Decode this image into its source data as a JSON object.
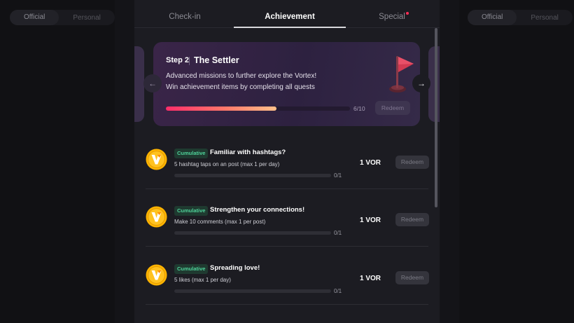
{
  "background": {
    "left_segment": [
      "Official",
      "Personal"
    ],
    "right_segment": [
      "Official",
      "Personal"
    ]
  },
  "tabs": [
    {
      "label": "Check-in",
      "active": false
    },
    {
      "label": "Achievement",
      "active": true
    },
    {
      "label": "Special",
      "active": false,
      "has_notification_dot": true
    }
  ],
  "step_card": {
    "step": "Step 2",
    "title": "The Settler",
    "desc_line1": "Advanced missions to further explore the Vortex!",
    "desc_line2": "Win achievement items by completing all quests",
    "progress": 0.6,
    "progress_text": "6/10",
    "redeem_label": "Redeem",
    "icon": "flag-icon"
  },
  "missions": [
    {
      "badge": "Cumulative",
      "title": "Familiar with hashtags?",
      "desc": "5 hashtag taps on an post (max 1 per day)",
      "progress": 0,
      "progress_text": "0/1",
      "reward": "1 VOR",
      "redeem_label": "Redeem",
      "icon": "vortex-coin-icon"
    },
    {
      "badge": "Cumulative",
      "title": "Strengthen your connections!",
      "desc": "Make 10 comments (max 1 per post)",
      "progress": 0,
      "progress_text": "0/1",
      "reward": "1 VOR",
      "redeem_label": "Redeem",
      "icon": "vortex-coin-icon"
    },
    {
      "badge": "Cumulative",
      "title": "Spreading love!",
      "desc": "5 likes (max 1 per day)",
      "progress": 0,
      "progress_text": "0/1",
      "reward": "1 VOR",
      "redeem_label": "Redeem",
      "icon": "vortex-coin-icon"
    }
  ],
  "colors": {
    "accent_pink": "#ff2d6a",
    "badge_green": "#4fd39a",
    "coin_yellow": "#ffb400"
  }
}
